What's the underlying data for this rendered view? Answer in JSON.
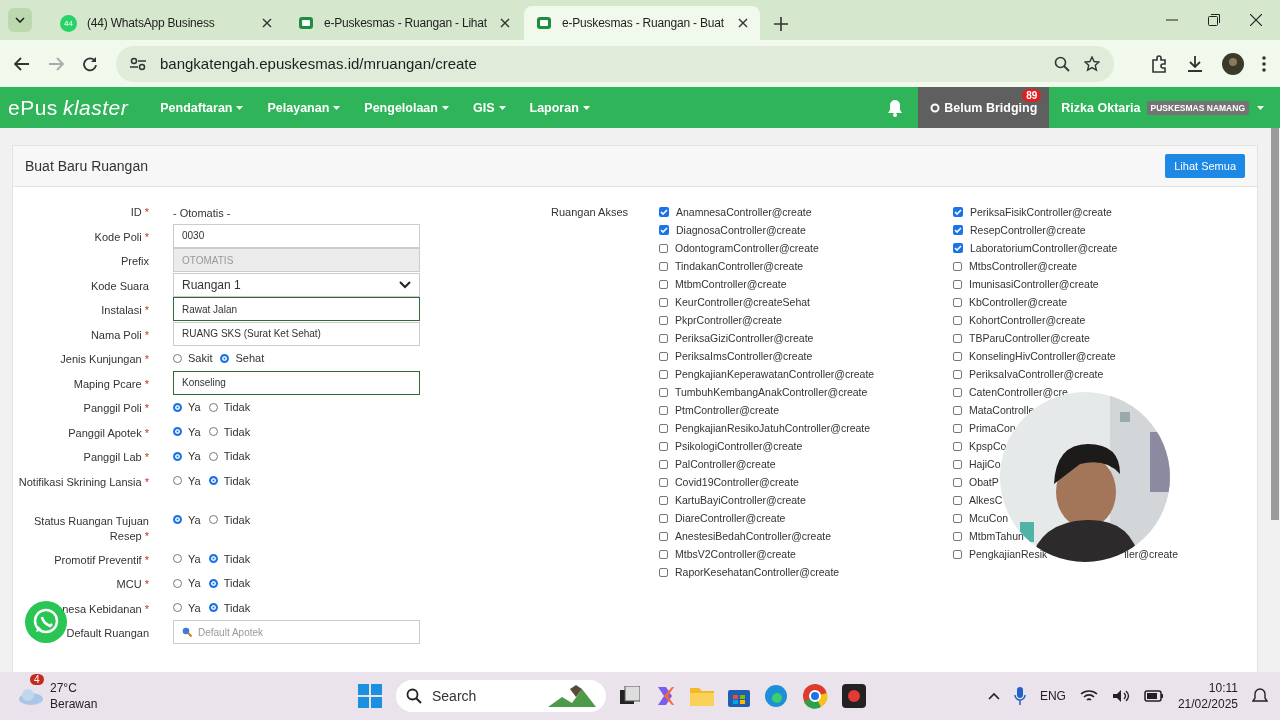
{
  "browser": {
    "tabs": [
      {
        "title": "(44) WhatsApp Business",
        "badge": "44",
        "kind": "whatsapp",
        "selected": false
      },
      {
        "title": "e-Puskesmas - Ruangan - Lihat",
        "kind": "doc",
        "selected": false
      },
      {
        "title": "e-Puskesmas - Ruangan - Buat",
        "kind": "doc",
        "selected": true
      }
    ],
    "url": "bangkatengah.epuskesmas.id/mruangan/create"
  },
  "navbar": {
    "logo_main": "ePus",
    "logo_sub": "klaster",
    "menu": [
      "Pendaftaran",
      "Pelayanan",
      "Pengelolaan",
      "GIS",
      "Laporan"
    ],
    "bridging": "Belum Bridging",
    "bridging_count": "89",
    "user": "Rizka Oktaria",
    "unit": "PUSKESMAS NAMANG"
  },
  "card": {
    "title": "Buat Baru Ruangan",
    "button": "Lihat Semua"
  },
  "form": [
    {
      "label": "ID",
      "required": "*",
      "kind": "static",
      "value": "- Otomatis -"
    },
    {
      "label": "Kode Poli",
      "required": "*",
      "kind": "text",
      "value": "0030"
    },
    {
      "label": "Prefix",
      "kind": "text",
      "value": "OTOMATIS",
      "disabled": true
    },
    {
      "label": "Kode Suara",
      "kind": "select",
      "value": "Ruangan 1"
    },
    {
      "label": "Instalasi",
      "required": "*",
      "kind": "combo",
      "value": "Rawat Jalan"
    },
    {
      "label": "Nama Poli",
      "required": "*",
      "kind": "text",
      "value": "RUANG SKS (Surat Ket Sehat)"
    },
    {
      "label": "Jenis Kunjungan",
      "required": "*",
      "kind": "radio",
      "options": [
        {
          "label": "Sakit",
          "selected": false
        },
        {
          "label": "Sehat",
          "selected": true
        }
      ]
    },
    {
      "label": "Maping Pcare",
      "required": "*",
      "kind": "combo",
      "value": "Konseling"
    },
    {
      "label": "Panggil Poli",
      "required": "*",
      "kind": "radio",
      "options": [
        {
          "label": "Ya",
          "selected": true
        },
        {
          "label": "Tidak",
          "selected": false
        }
      ]
    },
    {
      "label": "Panggil Apotek",
      "required": "*",
      "kind": "radio",
      "options": [
        {
          "label": "Ya",
          "selected": true
        },
        {
          "label": "Tidak",
          "selected": false
        }
      ]
    },
    {
      "label": "Panggil Lab",
      "required": "*",
      "kind": "radio",
      "options": [
        {
          "label": "Ya",
          "selected": true
        },
        {
          "label": "Tidak",
          "selected": false
        }
      ]
    },
    {
      "label": "Notifikasi Skrining Lansia",
      "required": "*",
      "kind": "radio",
      "options": [
        {
          "label": "Ya",
          "selected": false
        },
        {
          "label": "Tidak",
          "selected": true
        }
      ]
    },
    {
      "label": "Status Ruangan Tujuan Resep",
      "required": "*",
      "kind": "radio",
      "options": [
        {
          "label": "Ya",
          "selected": true
        },
        {
          "label": "Tidak",
          "selected": false
        }
      ]
    },
    {
      "label": "Promotif Preventif",
      "required": "*",
      "kind": "radio",
      "options": [
        {
          "label": "Ya",
          "selected": false
        },
        {
          "label": "Tidak",
          "selected": true
        }
      ]
    },
    {
      "label": "MCU",
      "required": "*",
      "kind": "radio",
      "options": [
        {
          "label": "Ya",
          "selected": false
        },
        {
          "label": "Tidak",
          "selected": true
        }
      ]
    },
    {
      "label": "nesa Kebidanan",
      "required": "*",
      "kind": "radio",
      "options": [
        {
          "label": "Ya",
          "selected": false
        },
        {
          "label": "Tidak",
          "selected": true
        }
      ]
    },
    {
      "label": "Default Ruangan",
      "kind": "search",
      "placeholder": "Default Apotek"
    }
  ],
  "access": {
    "label": "Ruangan Akses",
    "columns": [
      [
        {
          "label": "AnamnesaController@create",
          "checked": true
        },
        {
          "label": "DiagnosaController@create",
          "checked": true
        },
        {
          "label": "OdontogramController@create",
          "checked": false
        },
        {
          "label": "TindakanController@create",
          "checked": false
        },
        {
          "label": "MtbmController@create",
          "checked": false
        },
        {
          "label": "KeurController@createSehat",
          "checked": false
        },
        {
          "label": "PkprController@create",
          "checked": false
        },
        {
          "label": "PeriksaGiziController@create",
          "checked": false
        },
        {
          "label": "PeriksaImsController@create",
          "checked": false
        },
        {
          "label": "PengkajianKeperawatanController@create",
          "checked": false
        },
        {
          "label": "TumbuhKembangAnakController@create",
          "checked": false
        },
        {
          "label": "PtmController@create",
          "checked": false
        },
        {
          "label": "PengkajianResikoJatuhController@create",
          "checked": false
        },
        {
          "label": "PsikologiController@create",
          "checked": false
        },
        {
          "label": "PalController@create",
          "checked": false
        },
        {
          "label": "Covid19Controller@create",
          "checked": false
        },
        {
          "label": "KartuBayiController@create",
          "checked": false
        },
        {
          "label": "DiareController@create",
          "checked": false
        },
        {
          "label": "AnestesiBedahController@create",
          "checked": false
        },
        {
          "label": "MtbsV2Controller@create",
          "checked": false
        },
        {
          "label": "RaporKesehatanController@create",
          "checked": false
        }
      ],
      [
        {
          "label": "PeriksaFisikController@create",
          "checked": true
        },
        {
          "label": "ResepController@create",
          "checked": true
        },
        {
          "label": "LaboratoriumController@create",
          "checked": true
        },
        {
          "label": "MtbsController@create",
          "checked": false
        },
        {
          "label": "ImunisasiController@create",
          "checked": false
        },
        {
          "label": "KbController@create",
          "checked": false
        },
        {
          "label": "KohortController@create",
          "checked": false
        },
        {
          "label": "TBParuController@create",
          "checked": false
        },
        {
          "label": "KonselingHivController@create",
          "checked": false
        },
        {
          "label": "PeriksaIvaController@create",
          "checked": false
        },
        {
          "label": "CatenController@cre",
          "checked": false
        },
        {
          "label": "MataControlle",
          "checked": false
        },
        {
          "label": "PrimaCon",
          "checked": false
        },
        {
          "label": "KpspCo",
          "checked": false
        },
        {
          "label": "HajiCo",
          "checked": false
        },
        {
          "label": "ObatP",
          "checked": false
        },
        {
          "label": "AlkesC",
          "checked": false
        },
        {
          "label": "McuCon",
          "checked": false
        },
        {
          "label": "MtbmTahun",
          "checked": false
        },
        {
          "label": "PengkajianResik",
          "tail": "ller@create",
          "checked": false
        }
      ]
    ]
  },
  "taskbar": {
    "weather_badge": "4",
    "temperature": "27°C",
    "weather": "Berawan",
    "search": "Search",
    "language": "ENG",
    "time": "10:11",
    "date": "21/02/2025"
  }
}
